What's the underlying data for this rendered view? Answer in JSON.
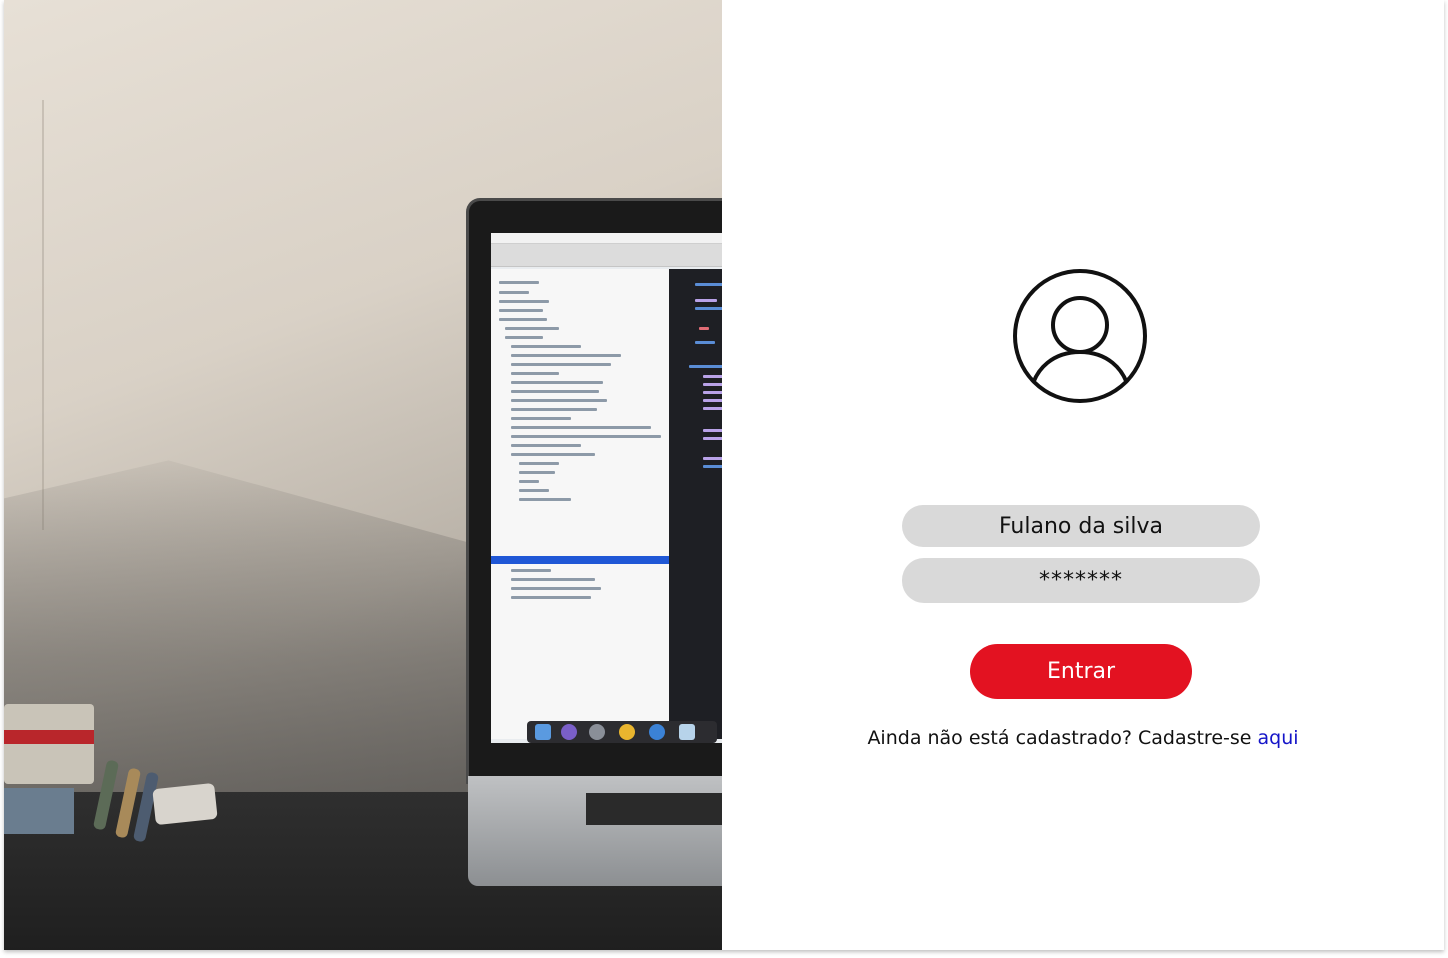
{
  "login": {
    "username_value": "Fulano da silva",
    "password_value": "*******",
    "submit_label": "Entrar",
    "signup_prompt": "Ainda não está cadastrado? Cadastre-se",
    "signup_link": "aqui"
  },
  "colors": {
    "primary_button": "#e31221",
    "input_background": "#d9d9d9",
    "link": "#1414c8"
  },
  "icons": {
    "avatar": "user-circle-icon"
  }
}
